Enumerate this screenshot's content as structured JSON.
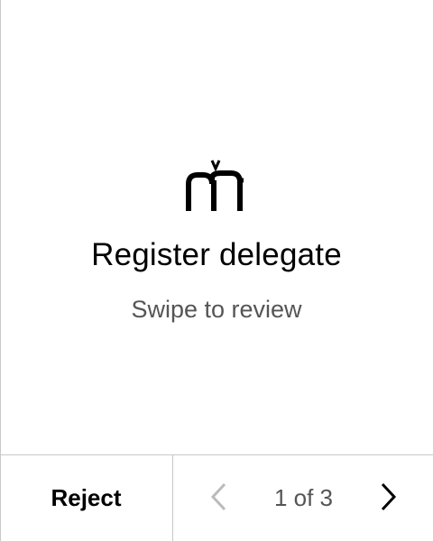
{
  "screen": {
    "title": "Register delegate",
    "subtitle": "Swipe to review",
    "app_icon": "mavryk-logo-icon"
  },
  "footer": {
    "reject_label": "Reject",
    "page_indicator": "1 of 3",
    "prev_icon": "chevron-left-icon",
    "next_icon": "chevron-right-icon"
  },
  "colors": {
    "background": "#ffffff",
    "text_primary": "#000000",
    "text_secondary": "#555555",
    "disabled": "#bbbbbb",
    "divider": "#c8c8c8"
  }
}
